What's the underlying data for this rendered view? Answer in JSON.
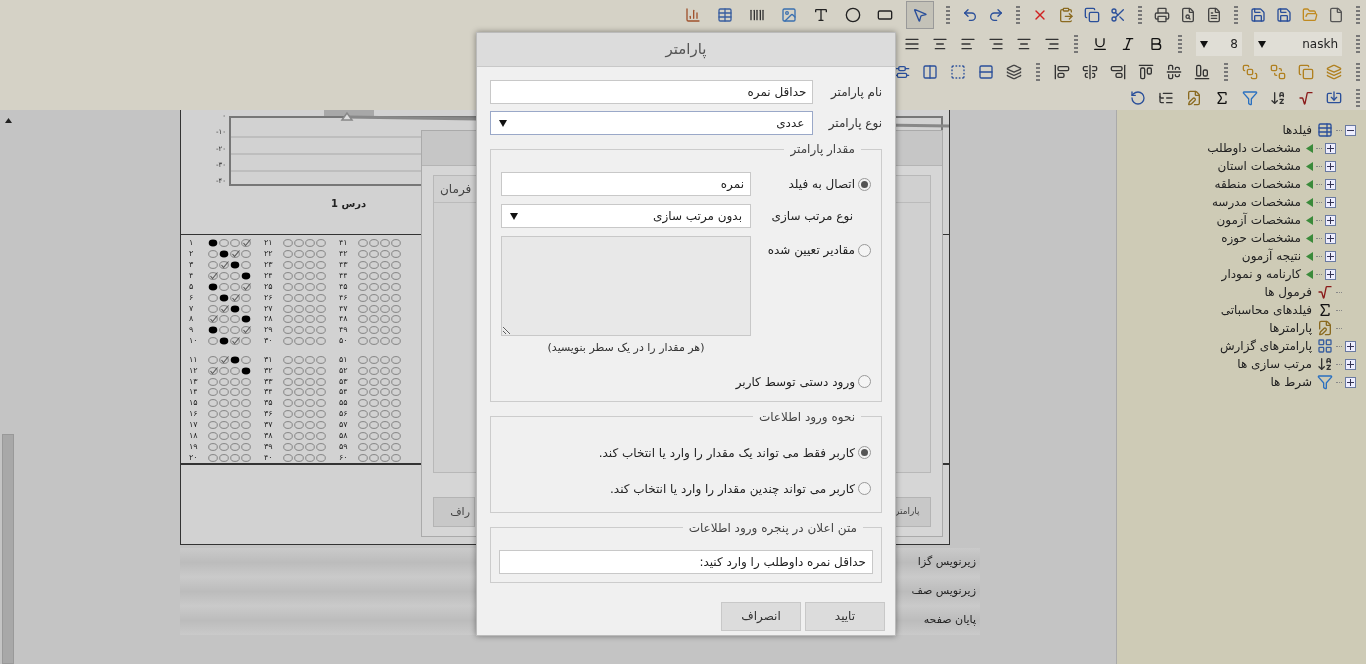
{
  "toolbar": {
    "tools": [
      {
        "kind": "chart",
        "selected": false
      },
      {
        "kind": "table",
        "selected": false
      },
      {
        "kind": "barcode",
        "selected": false
      },
      {
        "kind": "image",
        "selected": false
      },
      {
        "kind": "text",
        "selected": false
      },
      {
        "kind": "ellipse",
        "selected": false
      },
      {
        "kind": "rectangle",
        "selected": false
      },
      {
        "kind": "pointer",
        "selected": true
      }
    ],
    "font_size": "8",
    "font": "naskh"
  },
  "report": {
    "chart": {
      "yticks": [
        "۰",
        "-۱۰",
        "-۲۰",
        "-۳۰",
        "-۴۰"
      ],
      "xlabel": "درس 1"
    },
    "answer_sheet": {
      "columns": [
        {
          "rows": [
            {
              "number": "۴۱",
              "bubbles": [
                {
                  "kind": "empty"
                },
                {
                  "kind": "empty"
                },
                {
                  "kind": "empty"
                },
                {
                  "kind": "empty"
                }
              ]
            },
            {
              "number": "۴۲",
              "bubbles": [
                {
                  "kind": "empty"
                },
                {
                  "kind": "empty"
                },
                {
                  "kind": "empty"
                },
                {
                  "kind": "empty"
                }
              ]
            },
            {
              "number": "۴۳",
              "bubbles": [
                {
                  "kind": "empty"
                },
                {
                  "kind": "empty"
                },
                {
                  "kind": "empty"
                },
                {
                  "kind": "empty"
                }
              ]
            },
            {
              "number": "۴۴",
              "bubbles": [
                {
                  "kind": "empty"
                },
                {
                  "kind": "empty"
                },
                {
                  "kind": "empty"
                },
                {
                  "kind": "empty"
                }
              ]
            },
            {
              "number": "۴۵",
              "bubbles": [
                {
                  "kind": "empty"
                },
                {
                  "kind": "empty"
                },
                {
                  "kind": "empty"
                },
                {
                  "kind": "empty"
                }
              ]
            },
            {
              "number": "۴۶",
              "bubbles": [
                {
                  "kind": "empty"
                },
                {
                  "kind": "empty"
                },
                {
                  "kind": "empty"
                },
                {
                  "kind": "empty"
                }
              ]
            },
            {
              "number": "۴۷",
              "bubbles": [
                {
                  "kind": "empty"
                },
                {
                  "kind": "empty"
                },
                {
                  "kind": "empty"
                },
                {
                  "kind": "empty"
                }
              ]
            },
            {
              "number": "۴۸",
              "bubbles": [
                {
                  "kind": "empty"
                },
                {
                  "kind": "empty"
                },
                {
                  "kind": "empty"
                },
                {
                  "kind": "empty"
                }
              ]
            },
            {
              "number": "۴۹",
              "bubbles": [
                {
                  "kind": "empty"
                },
                {
                  "kind": "empty"
                },
                {
                  "kind": "empty"
                },
                {
                  "kind": "empty"
                }
              ]
            },
            {
              "number": "۵۰",
              "bubbles": [
                {
                  "kind": "empty"
                },
                {
                  "kind": "empty"
                },
                {
                  "kind": "empty"
                },
                {
                  "kind": "empty"
                }
              ]
            },
            {
              "number": "۵۱",
              "bubbles": [
                {
                  "kind": "empty"
                },
                {
                  "kind": "empty"
                },
                {
                  "kind": "empty"
                },
                {
                  "kind": "empty"
                }
              ]
            },
            {
              "number": "۵۲",
              "bubbles": [
                {
                  "kind": "empty"
                },
                {
                  "kind": "empty"
                },
                {
                  "kind": "empty"
                },
                {
                  "kind": "empty"
                }
              ]
            },
            {
              "number": "۵۳",
              "bubbles": [
                {
                  "kind": "empty"
                },
                {
                  "kind": "empty"
                },
                {
                  "kind": "empty"
                },
                {
                  "kind": "empty"
                }
              ]
            },
            {
              "number": "۵۴",
              "bubbles": [
                {
                  "kind": "empty"
                },
                {
                  "kind": "empty"
                },
                {
                  "kind": "empty"
                },
                {
                  "kind": "empty"
                }
              ]
            },
            {
              "number": "۵۵",
              "bubbles": [
                {
                  "kind": "empty"
                },
                {
                  "kind": "empty"
                },
                {
                  "kind": "empty"
                },
                {
                  "kind": "empty"
                }
              ]
            },
            {
              "number": "۵۶",
              "bubbles": [
                {
                  "kind": "empty"
                },
                {
                  "kind": "empty"
                },
                {
                  "kind": "empty"
                },
                {
                  "kind": "empty"
                }
              ]
            },
            {
              "number": "۵۷",
              "bubbles": [
                {
                  "kind": "empty"
                },
                {
                  "kind": "empty"
                },
                {
                  "kind": "empty"
                },
                {
                  "kind": "empty"
                }
              ]
            },
            {
              "number": "۵۸",
              "bubbles": [
                {
                  "kind": "empty"
                },
                {
                  "kind": "empty"
                },
                {
                  "kind": "empty"
                },
                {
                  "kind": "empty"
                }
              ]
            },
            {
              "number": "۵۹",
              "bubbles": [
                {
                  "kind": "empty"
                },
                {
                  "kind": "empty"
                },
                {
                  "kind": "empty"
                },
                {
                  "kind": "empty"
                }
              ]
            },
            {
              "number": "۶۰",
              "bubbles": [
                {
                  "kind": "empty"
                },
                {
                  "kind": "empty"
                },
                {
                  "kind": "empty"
                },
                {
                  "kind": "empty"
                }
              ]
            }
          ]
        },
        {
          "rows": [
            {
              "number": "۲۱",
              "bubbles": [
                {
                  "kind": "empty"
                },
                {
                  "kind": "empty"
                },
                {
                  "kind": "empty"
                },
                {
                  "kind": "empty"
                }
              ]
            },
            {
              "number": "۲۲",
              "bubbles": [
                {
                  "kind": "empty"
                },
                {
                  "kind": "empty"
                },
                {
                  "kind": "empty"
                },
                {
                  "kind": "empty"
                }
              ]
            },
            {
              "number": "۲۳",
              "bubbles": [
                {
                  "kind": "empty"
                },
                {
                  "kind": "empty"
                },
                {
                  "kind": "empty"
                },
                {
                  "kind": "empty"
                }
              ]
            },
            {
              "number": "۲۴",
              "bubbles": [
                {
                  "kind": "empty"
                },
                {
                  "kind": "empty"
                },
                {
                  "kind": "empty"
                },
                {
                  "kind": "empty"
                }
              ]
            },
            {
              "number": "۲۵",
              "bubbles": [
                {
                  "kind": "empty"
                },
                {
                  "kind": "empty"
                },
                {
                  "kind": "empty"
                },
                {
                  "kind": "empty"
                }
              ]
            },
            {
              "number": "۲۶",
              "bubbles": [
                {
                  "kind": "empty"
                },
                {
                  "kind": "empty"
                },
                {
                  "kind": "empty"
                },
                {
                  "kind": "empty"
                }
              ]
            },
            {
              "number": "۲۷",
              "bubbles": [
                {
                  "kind": "empty"
                },
                {
                  "kind": "empty"
                },
                {
                  "kind": "empty"
                },
                {
                  "kind": "empty"
                }
              ]
            },
            {
              "number": "۲۸",
              "bubbles": [
                {
                  "kind": "empty"
                },
                {
                  "kind": "empty"
                },
                {
                  "kind": "empty"
                },
                {
                  "kind": "empty"
                }
              ]
            },
            {
              "number": "۲۹",
              "bubbles": [
                {
                  "kind": "empty"
                },
                {
                  "kind": "empty"
                },
                {
                  "kind": "empty"
                },
                {
                  "kind": "empty"
                }
              ]
            },
            {
              "number": "۳۰",
              "bubbles": [
                {
                  "kind": "empty"
                },
                {
                  "kind": "empty"
                },
                {
                  "kind": "empty"
                },
                {
                  "kind": "empty"
                }
              ]
            },
            {
              "number": "۳۱",
              "bubbles": [
                {
                  "kind": "empty"
                },
                {
                  "kind": "empty"
                },
                {
                  "kind": "empty"
                },
                {
                  "kind": "empty"
                }
              ]
            },
            {
              "number": "۳۲",
              "bubbles": [
                {
                  "kind": "empty"
                },
                {
                  "kind": "empty"
                },
                {
                  "kind": "empty"
                },
                {
                  "kind": "empty"
                }
              ]
            },
            {
              "number": "۳۳",
              "bubbles": [
                {
                  "kind": "empty"
                },
                {
                  "kind": "empty"
                },
                {
                  "kind": "empty"
                },
                {
                  "kind": "empty"
                }
              ]
            },
            {
              "number": "۳۴",
              "bubbles": [
                {
                  "kind": "empty"
                },
                {
                  "kind": "empty"
                },
                {
                  "kind": "empty"
                },
                {
                  "kind": "empty"
                }
              ]
            },
            {
              "number": "۳۵",
              "bubbles": [
                {
                  "kind": "empty"
                },
                {
                  "kind": "empty"
                },
                {
                  "kind": "empty"
                },
                {
                  "kind": "empty"
                }
              ]
            },
            {
              "number": "۳۶",
              "bubbles": [
                {
                  "kind": "empty"
                },
                {
                  "kind": "empty"
                },
                {
                  "kind": "empty"
                },
                {
                  "kind": "empty"
                }
              ]
            },
            {
              "number": "۳۷",
              "bubbles": [
                {
                  "kind": "empty"
                },
                {
                  "kind": "empty"
                },
                {
                  "kind": "empty"
                },
                {
                  "kind": "empty"
                }
              ]
            },
            {
              "number": "۳۸",
              "bubbles": [
                {
                  "kind": "empty"
                },
                {
                  "kind": "empty"
                },
                {
                  "kind": "empty"
                },
                {
                  "kind": "empty"
                }
              ]
            },
            {
              "number": "۳۹",
              "bubbles": [
                {
                  "kind": "empty"
                },
                {
                  "kind": "empty"
                },
                {
                  "kind": "empty"
                },
                {
                  "kind": "empty"
                }
              ]
            },
            {
              "number": "۴۰",
              "bubbles": [
                {
                  "kind": "empty"
                },
                {
                  "kind": "empty"
                },
                {
                  "kind": "empty"
                },
                {
                  "kind": "empty"
                }
              ]
            }
          ]
        },
        {
          "rows": [
            {
              "number": "۱",
              "bubbles": [
                {
                  "kind": "filled"
                },
                {
                  "kind": "empty"
                },
                {
                  "kind": "empty"
                },
                {
                  "kind": "checked"
                }
              ]
            },
            {
              "number": "۲",
              "bubbles": [
                {
                  "kind": "empty"
                },
                {
                  "kind": "filled"
                },
                {
                  "kind": "checked"
                },
                {
                  "kind": "empty"
                }
              ]
            },
            {
              "number": "۳",
              "bubbles": [
                {
                  "kind": "empty"
                },
                {
                  "kind": "checked"
                },
                {
                  "kind": "filled"
                },
                {
                  "kind": "empty"
                }
              ]
            },
            {
              "number": "۴",
              "bubbles": [
                {
                  "kind": "checked"
                },
                {
                  "kind": "empty"
                },
                {
                  "kind": "empty"
                },
                {
                  "kind": "filled"
                }
              ]
            },
            {
              "number": "۵",
              "bubbles": [
                {
                  "kind": "filled"
                },
                {
                  "kind": "empty"
                },
                {
                  "kind": "empty"
                },
                {
                  "kind": "checked"
                }
              ]
            },
            {
              "number": "۶",
              "bubbles": [
                {
                  "kind": "empty"
                },
                {
                  "kind": "filled"
                },
                {
                  "kind": "checked"
                },
                {
                  "kind": "empty"
                }
              ]
            },
            {
              "number": "۷",
              "bubbles": [
                {
                  "kind": "empty"
                },
                {
                  "kind": "checked"
                },
                {
                  "kind": "filled"
                },
                {
                  "kind": "empty"
                }
              ]
            },
            {
              "number": "۸",
              "bubbles": [
                {
                  "kind": "checked"
                },
                {
                  "kind": "empty"
                },
                {
                  "kind": "empty"
                },
                {
                  "kind": "filled"
                }
              ]
            },
            {
              "number": "۹",
              "bubbles": [
                {
                  "kind": "filled"
                },
                {
                  "kind": "empty"
                },
                {
                  "kind": "empty"
                },
                {
                  "kind": "checked"
                }
              ]
            },
            {
              "number": "۱۰",
              "bubbles": [
                {
                  "kind": "empty"
                },
                {
                  "kind": "filled"
                },
                {
                  "kind": "checked"
                },
                {
                  "kind": "empty"
                }
              ]
            },
            {
              "number": "۱۱",
              "bubbles": [
                {
                  "kind": "empty"
                },
                {
                  "kind": "checked"
                },
                {
                  "kind": "filled"
                },
                {
                  "kind": "empty"
                }
              ]
            },
            {
              "number": "۱۲",
              "bubbles": [
                {
                  "kind": "checked"
                },
                {
                  "kind": "empty"
                },
                {
                  "kind": "empty"
                },
                {
                  "kind": "filled"
                }
              ]
            },
            {
              "number": "۱۳",
              "bubbles": [
                {
                  "kind": "empty"
                },
                {
                  "kind": "empty"
                },
                {
                  "kind": "empty"
                },
                {
                  "kind": "empty"
                }
              ]
            },
            {
              "number": "۱۴",
              "bubbles": [
                {
                  "kind": "empty"
                },
                {
                  "kind": "empty"
                },
                {
                  "kind": "empty"
                },
                {
                  "kind": "empty"
                }
              ]
            },
            {
              "number": "۱۵",
              "bubbles": [
                {
                  "kind": "empty"
                },
                {
                  "kind": "empty"
                },
                {
                  "kind": "empty"
                },
                {
                  "kind": "empty"
                }
              ]
            },
            {
              "number": "۱۶",
              "bubbles": [
                {
                  "kind": "empty"
                },
                {
                  "kind": "empty"
                },
                {
                  "kind": "empty"
                },
                {
                  "kind": "empty"
                }
              ]
            },
            {
              "number": "۱۷",
              "bubbles": [
                {
                  "kind": "empty"
                },
                {
                  "kind": "empty"
                },
                {
                  "kind": "empty"
                },
                {
                  "kind": "empty"
                }
              ]
            },
            {
              "number": "۱۸",
              "bubbles": [
                {
                  "kind": "empty"
                },
                {
                  "kind": "empty"
                },
                {
                  "kind": "empty"
                },
                {
                  "kind": "empty"
                }
              ]
            },
            {
              "number": "۱۹",
              "bubbles": [
                {
                  "kind": "empty"
                },
                {
                  "kind": "empty"
                },
                {
                  "kind": "empty"
                },
                {
                  "kind": "empty"
                }
              ]
            },
            {
              "number": "۲۰",
              "bubbles": [
                {
                  "kind": "empty"
                },
                {
                  "kind": "empty"
                },
                {
                  "kind": "empty"
                },
                {
                  "kind": "empty"
                }
              ]
            }
          ]
        }
      ]
    },
    "bands": [
      {
        "label": "زیرنویس گزا"
      },
      {
        "label": "زیرنویس صف"
      },
      {
        "label": "پایان صفحه"
      }
    ]
  },
  "background_dialog": {
    "tab": "فرمان",
    "buttons": [
      "پارامتر",
      "راف"
    ]
  },
  "tree": [
    {
      "label": "فیلدها",
      "kind": "fields",
      "expanded": true,
      "children": [
        {
          "label": "مشخصات داوطلب",
          "kind": "table",
          "expanded": false
        },
        {
          "label": "مشخصات استان",
          "kind": "table",
          "expanded": false
        },
        {
          "label": "مشخصات منطقه",
          "kind": "table",
          "expanded": false
        },
        {
          "label": "مشخصات مدرسه",
          "kind": "table",
          "expanded": false
        },
        {
          "label": "مشخصات آزمون",
          "kind": "table",
          "expanded": false
        },
        {
          "label": "مشخصات حوزه",
          "kind": "table",
          "expanded": false
        },
        {
          "label": "نتیجه آزمون",
          "kind": "table",
          "expanded": false
        },
        {
          "label": "کارنامه و نمودار",
          "kind": "table",
          "expanded": false
        }
      ]
    },
    {
      "label": "فرمول ها",
      "kind": "formula"
    },
    {
      "label": "فیلدهای محاسباتی",
      "kind": "sum"
    },
    {
      "label": "پارامترها",
      "kind": "parameter"
    },
    {
      "label": "پارامترهای گزارش",
      "kind": "report-parameters",
      "expanded": false
    },
    {
      "label": "مرتب سازی ها",
      "kind": "sort",
      "expanded": false
    },
    {
      "label": "شرط ها",
      "kind": "filter",
      "expanded": false
    }
  ],
  "dialog": {
    "title": "پارامتر",
    "name": {
      "label": "نام پارامتر",
      "value": "حداقل نمره"
    },
    "type": {
      "label": "نوع پارامتر",
      "value": "عددی"
    },
    "value_section": {
      "legend": "مقدار پارامتر",
      "field_link": {
        "label": "اتصال به فیلد",
        "selected": true,
        "value": "نمره"
      },
      "sort": {
        "label": "نوع مرتب سازی",
        "value": "بدون مرتب سازی"
      },
      "fixed_values": {
        "label": "مقادیر تعیین شده",
        "selected": false,
        "hint": "(هر مقدار را در یک سطر بنویسید)"
      },
      "manual": {
        "label": "ورود دستی توسط کاربر",
        "selected": false
      }
    },
    "input_section": {
      "legend": "نحوه ورود اطلاعات",
      "options": [
        {
          "label": "کاربر فقط می تواند یک مقدار را وارد یا انتخاب کند.",
          "selected": true
        },
        {
          "label": "کاربر می تواند چندین مقدار را وارد یا انتخاب کند.",
          "selected": false
        }
      ]
    },
    "prompt_section": {
      "legend": "متن اعلان در پنجره ورود اطلاعات",
      "value": "حداقل نمره داوطلب را وارد کنید:"
    },
    "buttons": {
      "ok": "تایید",
      "cancel": "انصراف"
    }
  }
}
